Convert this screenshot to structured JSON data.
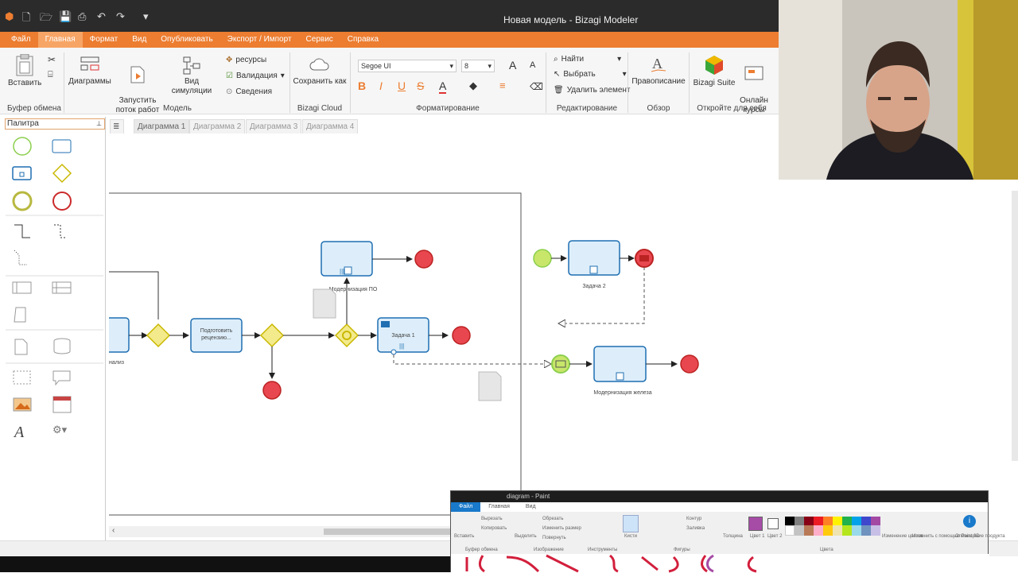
{
  "app": {
    "title": "Новая модель - Bizagi Modeler"
  },
  "menu": [
    "Файл",
    "Главная",
    "Формат",
    "Вид",
    "Опубликовать",
    "Экспорт / Импорт",
    "Сервис",
    "Справка"
  ],
  "ribbon": {
    "paste": "Вставить",
    "clipboard_group": "Буфер обмена",
    "diagrams": "Диаграммы",
    "run_processes": "Запустить\nпоток работ",
    "simulation_view": "Вид симуляции",
    "resources": "ресурсы",
    "validation": "Валидация",
    "info": "Сведения",
    "model_group": "Модель",
    "save_as": "Сохранить как",
    "cloud_group": "Bizagi Cloud",
    "font_family": "Segoe UI",
    "font_size": "8",
    "format_group": "Форматирование",
    "find": "Найти",
    "select": "Выбрать",
    "delete_element": "Удалить элемент",
    "edit_group": "Редактирование",
    "spelling": "Правописание",
    "review_group": "Обзор",
    "bizagi_suite": "Bizagi Suite",
    "online_courses": "Онлайн\nкурсы",
    "discover_group": "Откройте для себя"
  },
  "palette": {
    "title": "Палитра"
  },
  "tabs": [
    "Диаграмма 1",
    "Диаграмма 2",
    "Диаграмма 3",
    "Диаграмма 4"
  ],
  "diagram": {
    "task_modernization_po": "Модернизация ПО",
    "task_prepare_review": "Подготовить\nрецензию...",
    "task_1": "Задача 1",
    "task_2": "Задача 2",
    "task_modernization_hw": "Модернизация железа",
    "partial_label": "нализ"
  },
  "paint": {
    "title": "diagram - Paint",
    "menu": [
      "Файл",
      "Главная",
      "Вид"
    ],
    "paste": "Вставить",
    "cut": "Вырезать",
    "copy": "Копировать",
    "clipboard": "Буфер обмена",
    "crop": "Обрезать",
    "resize": "Изменить размер",
    "rotate": "Повернуть",
    "select": "Выделить",
    "image": "Изображение",
    "tools": "Инструменты",
    "brushes": "Кисти",
    "outline": "Контур",
    "fill": "Заливка",
    "shapes": "Фигуры",
    "size": "Толщина",
    "color1": "Цвет 1",
    "color2": "Цвет 2",
    "edit_colors": "Изменение цветов",
    "paint3d": "Изменить с помощью Paint 3D",
    "product_alert": "Оповещение продукта",
    "colors": "Цвета"
  },
  "colors": {
    "accent": "#ec7d31",
    "task_fill": "#ddeefa",
    "task_stroke": "#1f6fb2",
    "end_event": "#e8474f",
    "gateway": "#f3ea8c",
    "start_event": "#c8e66a"
  }
}
